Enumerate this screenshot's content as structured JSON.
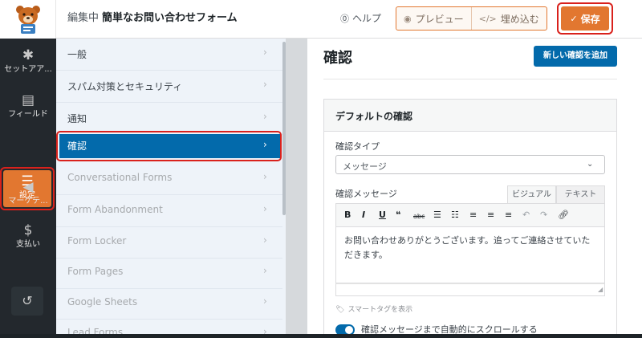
{
  "header": {
    "editing_prefix": "編集中",
    "form_name": "簡単なお問い合わせフォーム",
    "help": "ヘルプ",
    "preview": "プレビュー",
    "embed": "埋め込む",
    "save": "保存"
  },
  "leftnav": {
    "items": [
      {
        "label": "セットアア...",
        "icon": "gear-icon"
      },
      {
        "label": "フィールド",
        "icon": "fields-icon"
      },
      {
        "label": "設定",
        "icon": "sliders-icon",
        "active": true
      },
      {
        "label": "マーケテ...",
        "icon": "megaphone-icon"
      },
      {
        "label": "支払い",
        "icon": "dollar-icon"
      }
    ],
    "history_icon": "history-icon"
  },
  "settings_panel": {
    "items": [
      {
        "label": "一般"
      },
      {
        "label": "スパム対策とセキュリティ"
      },
      {
        "label": "通知"
      },
      {
        "label": "確認",
        "active": true
      },
      {
        "label": "Conversational Forms"
      },
      {
        "label": "Form Abandonment"
      },
      {
        "label": "Form Locker"
      },
      {
        "label": "Form Pages"
      },
      {
        "label": "Google Sheets"
      },
      {
        "label": "Lead Forms"
      }
    ]
  },
  "main": {
    "title": "確認",
    "add_button": "新しい確認を追加",
    "card_title": "デフォルトの確認",
    "type_label": "確認タイプ",
    "type_value": "メッセージ",
    "message_label": "確認メッセージ",
    "tab_visual": "ビジュアル",
    "tab_text": "テキスト",
    "editor_text": "お問い合わせありがとうございます。追ってご連絡させていただきます。",
    "smart_tags": "スマートタグを表示",
    "scroll_toggle_label": "確認メッセージまで自動的にスクロールする",
    "scroll_toggle_on": true
  },
  "colors": {
    "accent_orange": "#e27730",
    "primary_blue": "#036aab",
    "highlight_red": "#d9211c",
    "nav_dark": "#23282d"
  }
}
